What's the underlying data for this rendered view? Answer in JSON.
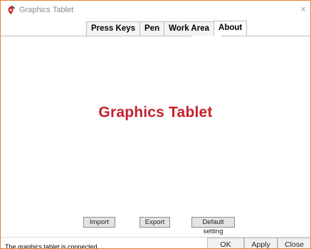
{
  "window": {
    "title": "Graphics Tablet",
    "close_glyph": "×",
    "icon": "pen-nib-icon",
    "border_color": "#e8822e"
  },
  "tabs": [
    {
      "label": "Press Keys",
      "active": false
    },
    {
      "label": "Pen",
      "active": false
    },
    {
      "label": "Work Area",
      "active": false
    },
    {
      "label": "About",
      "active": true
    }
  ],
  "about": {
    "brand_text": "Graphics Tablet",
    "brand_color": "#c7202f"
  },
  "actions": {
    "import_label": "Import",
    "export_label": "Export",
    "default_label": "Default setting"
  },
  "footer": {
    "status": "The graphics tablet is connected",
    "ok_label": "OK",
    "apply_label": "Apply",
    "close_label": "Close"
  }
}
